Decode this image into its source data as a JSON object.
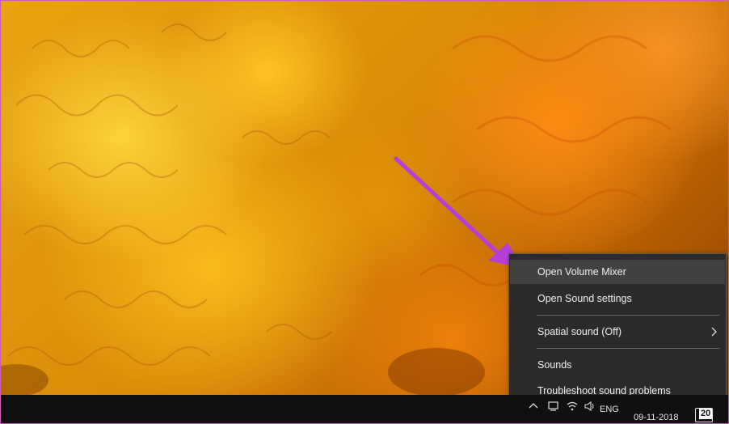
{
  "context_menu": {
    "items": [
      {
        "label": "Open Volume Mixer",
        "hovered": true
      },
      {
        "label": "Open Sound settings",
        "hovered": false
      },
      {
        "label": "Spatial sound (Off)",
        "has_submenu": true
      },
      {
        "label": "Sounds"
      },
      {
        "label": "Troubleshoot sound problems"
      }
    ]
  },
  "taskbar": {
    "language": "ENG",
    "date": "09-11-2018",
    "notification_count": "20",
    "icons": [
      "chevron-up-icon",
      "network-icon",
      "wifi-icon",
      "volume-icon"
    ]
  },
  "colors": {
    "annotation_arrow": "#b53fd6",
    "frame_border": "#d15ab9",
    "menu_background": "#2b2b2b",
    "menu_hover": "#414141",
    "taskbar_background": "#101010"
  }
}
